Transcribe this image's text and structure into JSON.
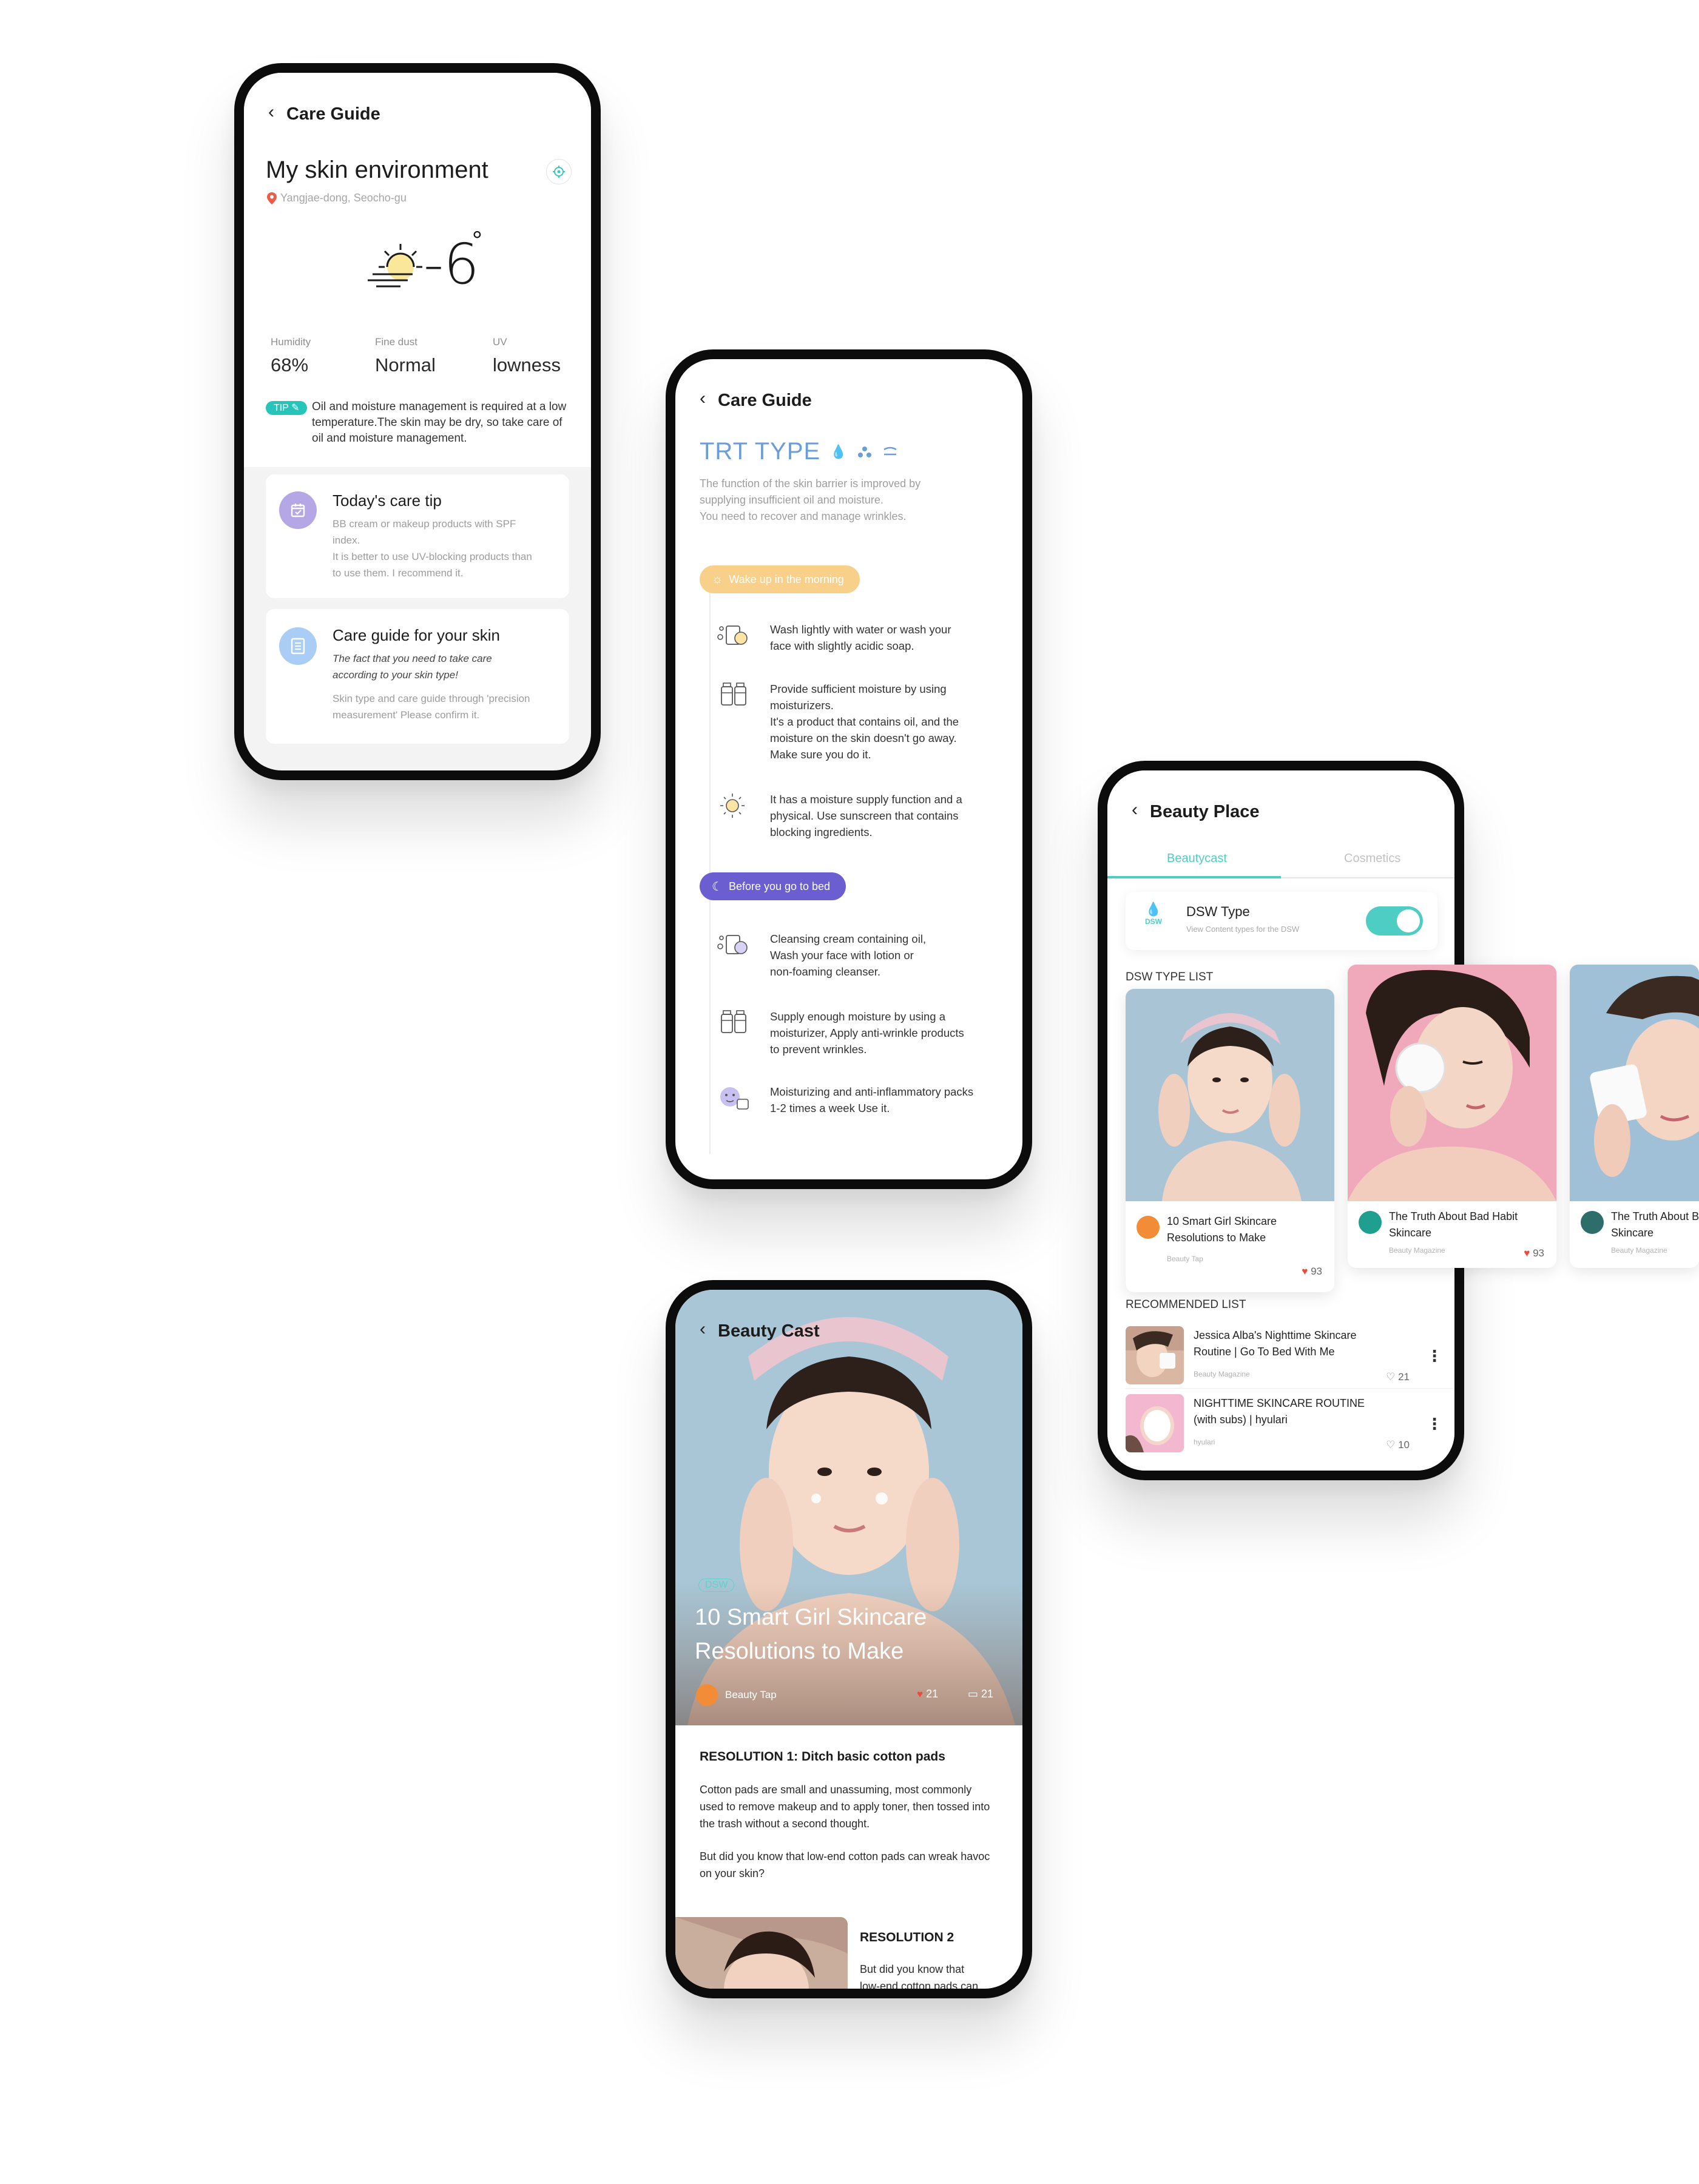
{
  "care_guide_env": {
    "header": {
      "back": "‹",
      "title": "Care Guide"
    },
    "title": "My skin environment",
    "location": "Yangjae-dong, Seocho-gu",
    "temperature": "-6",
    "degree": "°",
    "stats": [
      {
        "label": "Humidity",
        "value": "68%"
      },
      {
        "label": "Fine dust",
        "value": "Normal"
      },
      {
        "label": "UV",
        "value": "lowness"
      }
    ],
    "tip": {
      "badge": "TIP",
      "lines": [
        "Oil and moisture management is required at a low",
        "temperature.The skin may be dry, so take care of",
        "oil and moisture management."
      ]
    },
    "care_tip": {
      "title": "Today's care tip",
      "lines": [
        "BB cream or makeup products with SPF",
        "index.",
        "It is better to use UV-blocking products than",
        "to use them. I recommend it."
      ]
    },
    "care_guide": {
      "title": "Care guide for your skin",
      "em_lines": [
        "The fact that you need to take care",
        "according to your skin type!"
      ],
      "lines": [
        "Skin type and care guide through 'precision",
        "measurement' Please confirm it."
      ]
    }
  },
  "trt": {
    "header": {
      "back": "‹",
      "title": "Care Guide"
    },
    "title": "TRT TYPE",
    "desc_lines": [
      "The function of the skin barrier is improved by",
      "supplying insufficient oil and moisture.",
      "You need to recover and manage wrinkles."
    ],
    "morning": {
      "label": "Wake up in the morning",
      "steps": [
        {
          "icon": "face-wash-icon",
          "lines": [
            "Wash lightly with water or wash your",
            "face with slightly acidic soap."
          ]
        },
        {
          "icon": "moisturizer-icon",
          "lines": [
            "Provide sufficient moisture by using",
            "moisturizers.",
            "It's a product that contains oil, and the",
            "moisture on the skin doesn't go away.",
            "Make sure you do it."
          ]
        },
        {
          "icon": "sun-icon",
          "lines": [
            "It has a moisture supply function and a",
            "physical. Use sunscreen that contains",
            "blocking ingredients."
          ]
        }
      ]
    },
    "night": {
      "label": "Before you go to bed",
      "steps": [
        {
          "icon": "cleansing-icon",
          "lines": [
            "Cleansing cream containing oil,",
            "Wash your face with lotion or",
            "non-foaming cleanser."
          ]
        },
        {
          "icon": "moisturizer-icon",
          "lines": [
            "Supply enough moisture by using a",
            "moisturizer, Apply anti-wrinkle products",
            "to prevent wrinkles."
          ]
        },
        {
          "icon": "face-pack-icon",
          "lines": [
            "Moisturizing and anti-inflammatory packs",
            "1-2 times a week Use it."
          ]
        }
      ]
    }
  },
  "beauty_place": {
    "header": {
      "back": "‹",
      "title": "Beauty Place"
    },
    "tabs": [
      {
        "label": "Beautycast",
        "active": true
      },
      {
        "label": "Cosmetics",
        "active": false
      }
    ],
    "dsw": {
      "badge": "DSW",
      "title": "DSW Type",
      "subtitle": "View Content types for the DSW",
      "toggle_on": true
    },
    "dsw_list_label": "DSW TYPE LIST",
    "cards": [
      {
        "title_lines": [
          "10 Smart Girl Skincare",
          "Resolutions to Make"
        ],
        "source": "Beauty Tap",
        "likes": "93"
      },
      {
        "title_lines": [
          "The Truth About Bad Habit",
          "Skincare"
        ],
        "source": "Beauty Magazine",
        "likes": "93"
      },
      {
        "title_lines": [
          "The Truth About B",
          "Skincare"
        ],
        "source": "Beauty Magazine",
        "likes": ""
      }
    ],
    "recommended_label": "RECOMMENDED LIST",
    "recommended": [
      {
        "title_lines": [
          "Jessica Alba's Nighttime Skincare",
          "Routine | Go To Bed With Me"
        ],
        "source": "Beauty Magazine",
        "likes": "21"
      },
      {
        "title_lines": [
          "NIGHTTIME SKINCARE ROUTINE",
          "(with subs) | hyulari"
        ],
        "source": "hyulari",
        "likes": "10"
      }
    ]
  },
  "beauty_cast": {
    "header": {
      "back": "‹",
      "title": "Beauty Cast"
    },
    "category": "DSW",
    "title_lines": [
      "10 Smart Girl Skincare",
      "Resolutions to Make"
    ],
    "author": "Beauty Tap",
    "likes": "21",
    "comments": "21",
    "resolution1": {
      "heading": "RESOLUTION 1: Ditch basic cotton pads",
      "para1": [
        "Cotton pads are small and unassuming, most commonly",
        "used to remove makeup and to apply toner, then tossed into",
        "the trash without a second thought."
      ],
      "para2": [
        "But did you know that low-end cotton pads can wreak havoc",
        "on your skin?"
      ]
    },
    "resolution2": {
      "heading": "RESOLUTION 2",
      "lines": [
        "But did you know that",
        "low-end cotton pads can"
      ]
    }
  },
  "colors": {
    "accent_teal": "#27c4b9",
    "trt_blue": "#6b9dd8",
    "morning_pill": "#f8d08a",
    "night_pill": "#6a5ed0",
    "heart_red": "#ec4b3c",
    "toggle_on": "#4ecdc4"
  }
}
